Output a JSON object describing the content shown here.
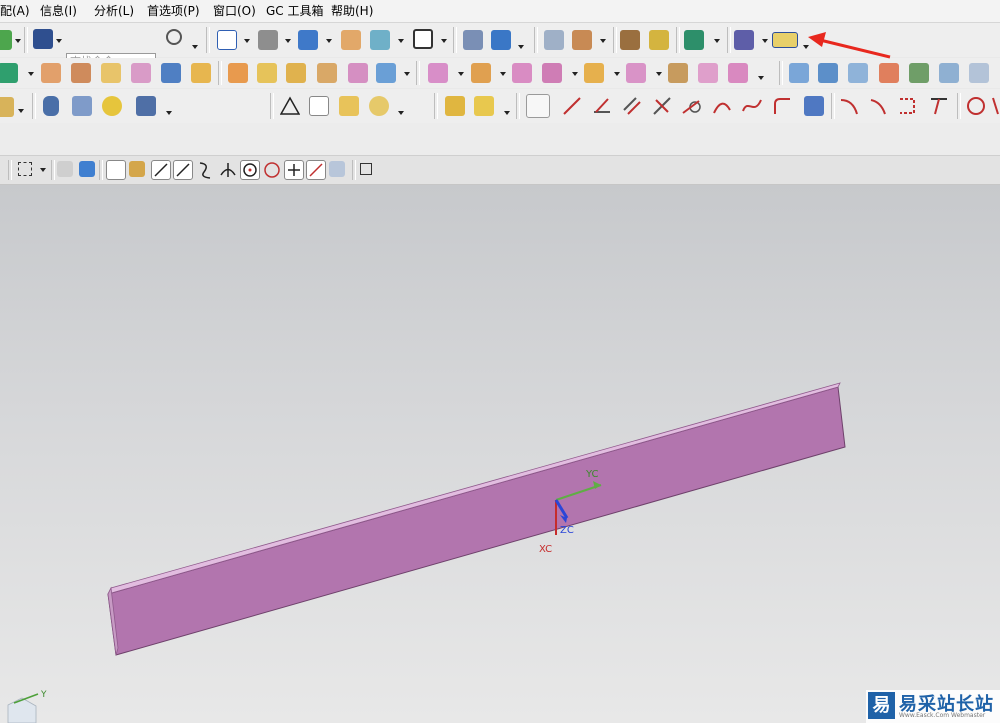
{
  "menu": {
    "items": [
      "配(A)",
      "信息(I)",
      "分析(L)",
      "首选项(P)",
      "窗口(O)",
      "GC 工具箱",
      "帮助(H)"
    ]
  },
  "search": {
    "placeholder": "查找命令"
  },
  "toolbar": {
    "highlighted_tool": "measure-distance-ruler-icon",
    "annotation_arrow_color": "#e8281e"
  },
  "viewport": {
    "csys_labels": {
      "yc": "YC",
      "xc": "XC",
      "zc": "ZC"
    },
    "triad_label": "Y",
    "part_color": "#b275ae"
  },
  "watermark": {
    "logo_char": "易",
    "title": "易采站长站",
    "subtitle": "Www.Easck.Com Webmaster"
  }
}
